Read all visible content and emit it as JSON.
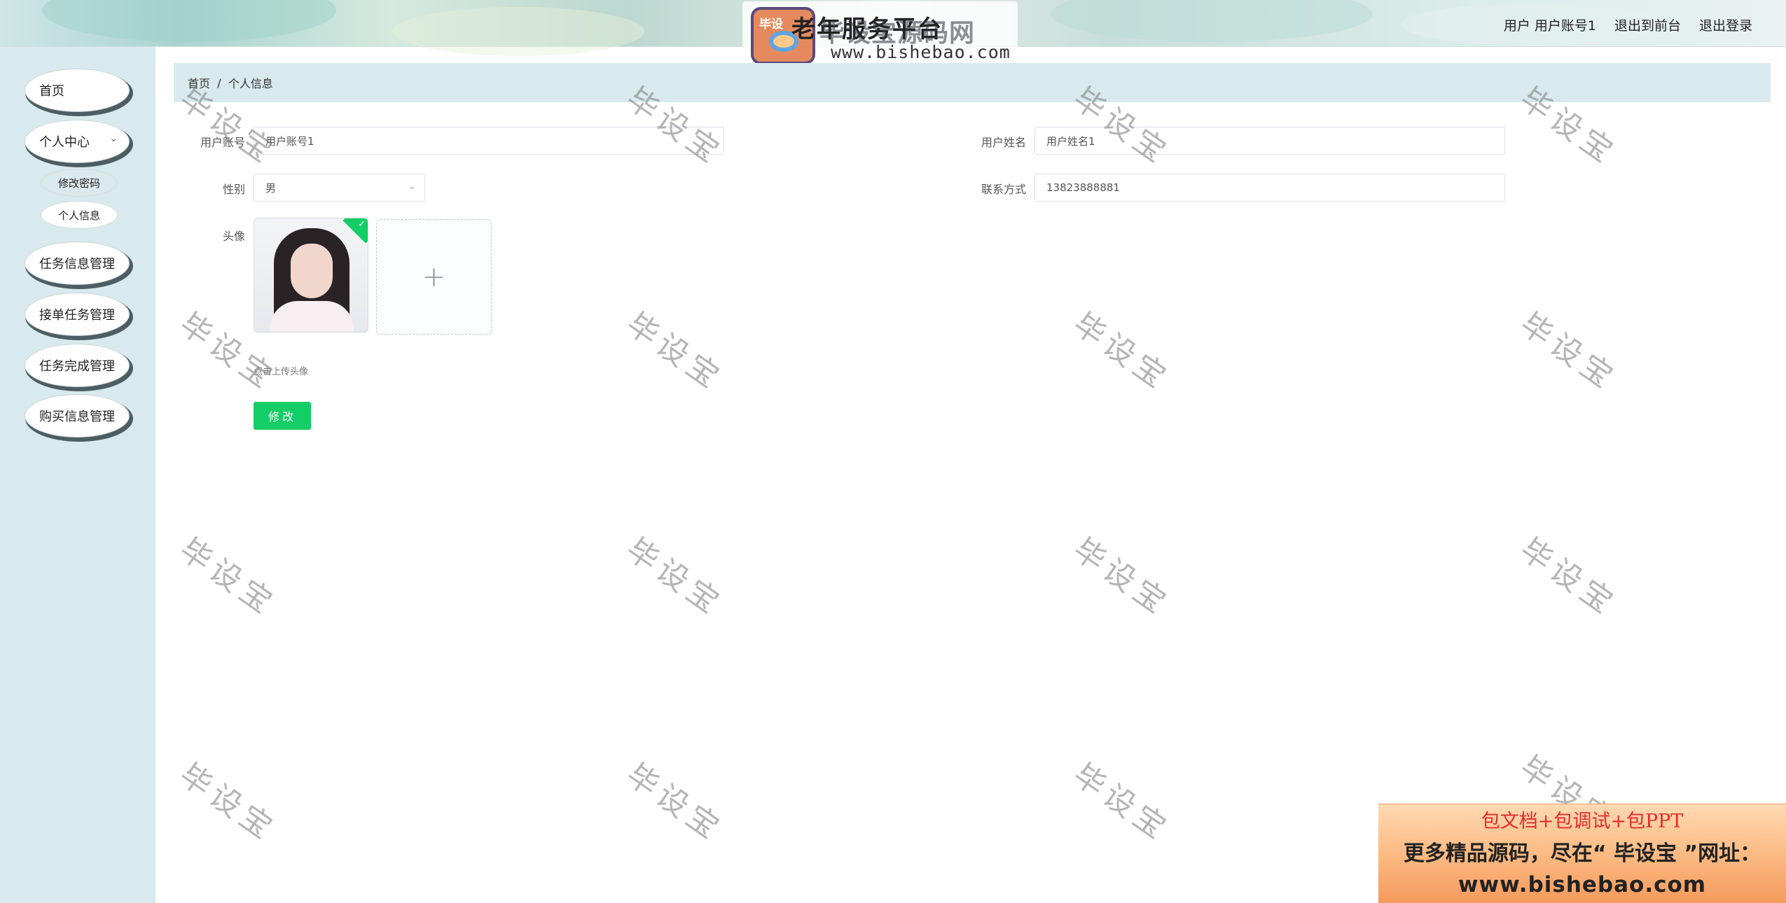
{
  "header": {
    "app_title": "老年服务平台",
    "logo_tag": "毕设",
    "logo_title": "毕设宝源码网",
    "logo_url": "www.bishebao.com",
    "user_label": "用户 用户账号1",
    "front_link": "退出到前台",
    "logout_link": "退出登录"
  },
  "sidebar": {
    "home": "首页",
    "personal_center": "个人中心",
    "change_password": "修改密码",
    "personal_info": "个人信息",
    "task_info": "任务信息管理",
    "order_task": "接单任务管理",
    "task_complete": "任务完成管理",
    "purchase_info": "购买信息管理"
  },
  "breadcrumb": {
    "home": "首页",
    "separator": "/",
    "current": "个人信息"
  },
  "form": {
    "account_label": "用户账号",
    "account_value": "用户账号1",
    "name_label": "用户姓名",
    "name_value": "用户姓名1",
    "gender_label": "性别",
    "gender_value": "男",
    "phone_label": "联系方式",
    "phone_value": "13823888881",
    "avatar_label": "头像",
    "upload_hint": "点击上传头像",
    "submit": "修改"
  },
  "watermark": "毕设宝",
  "ad": {
    "line1": "包文档+包调试+包PPT",
    "line2": "更多精品源码，尽在“ 毕设宝 ”网址：",
    "line3": "www.bishebao.com"
  },
  "colors": {
    "accent": "#13ce66",
    "sidebar_bg": "#d9eaee",
    "ad_text_red": "#e22c2c"
  }
}
